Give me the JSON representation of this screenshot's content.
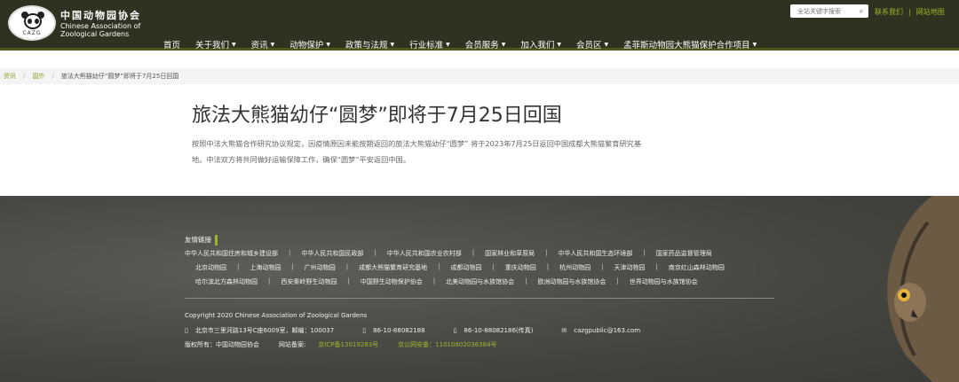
{
  "header": {
    "org_name_cn": "中国动物园协会",
    "org_name_en_line1": "Chinese Association of",
    "org_name_en_line2": "Zoological Gardens",
    "logo_text": "CAZG",
    "search_placeholder": "全站关键字搜索",
    "links": [
      "联系我们",
      "网站地图"
    ],
    "nav": [
      {
        "label": "首页",
        "caret": false
      },
      {
        "label": "关于我们",
        "caret": true
      },
      {
        "label": "资讯",
        "caret": true
      },
      {
        "label": "动物保护",
        "caret": true
      },
      {
        "label": "政策与法规",
        "caret": true
      },
      {
        "label": "行业标准",
        "caret": true
      },
      {
        "label": "会员服务",
        "caret": true
      },
      {
        "label": "加入我们",
        "caret": true
      },
      {
        "label": "会员区",
        "caret": true
      },
      {
        "label": "孟菲斯动物园大熊猫保护合作项目",
        "caret": true
      }
    ]
  },
  "breadcrumb": [
    "资讯",
    "国外",
    "旅法大熊猫幼仔“圆梦”即将于7月25日回国"
  ],
  "article": {
    "title": "旅法大熊猫幼仔“圆梦”即将于7月25日回国",
    "paragraph": "按照中法大熊猫合作研究协议规定，因疫情原因未能按期返回的旅法大熊猫幼仔“圆梦” 将于2023年7月25日返回中国成都大熊猫繁育研究基地。中法双方将共同做好运输保障工作，确保“圆梦”平安返回中国。"
  },
  "footer": {
    "links_title": "友情链接",
    "links_row1": [
      "中华人民共和国住房和城乡建设部",
      "中华人民共和国民政部",
      "中华人民共和国农业农村部",
      "国家林业和草原局",
      "中华人民共和国生态环境部",
      "国家药品监督管理局"
    ],
    "links_row2": [
      "北京动物园",
      "上海动物园",
      "广州动物园",
      "成都大熊猫繁育研究基地",
      "成都动物园",
      "重庆动物园",
      "杭州动物园",
      "天津动物园",
      "南京红山森林动物园"
    ],
    "links_row3": [
      "哈尔滨北方森林动物园",
      "西安秦岭野生动物园",
      "中国野生动物保护协会",
      "北美动物园与水族馆协会",
      "欧洲动物园与水族馆协会",
      "世界动物园与水族馆协会"
    ],
    "copyright": "Copyright 2020 Chinese Association of Zoological Gardens",
    "address": "北京市三里河路13号C座6009室，邮编：100037",
    "phone": "86-10-88082188",
    "fax": "86-10-88082186(传真)",
    "email": "cazgpublic@163.com",
    "rights_label": "版权所有：中国动物园协会",
    "record_label": "网站备案:",
    "icp": "京ICP备13019283号",
    "police": "京公网安备：11010802036384号"
  }
}
